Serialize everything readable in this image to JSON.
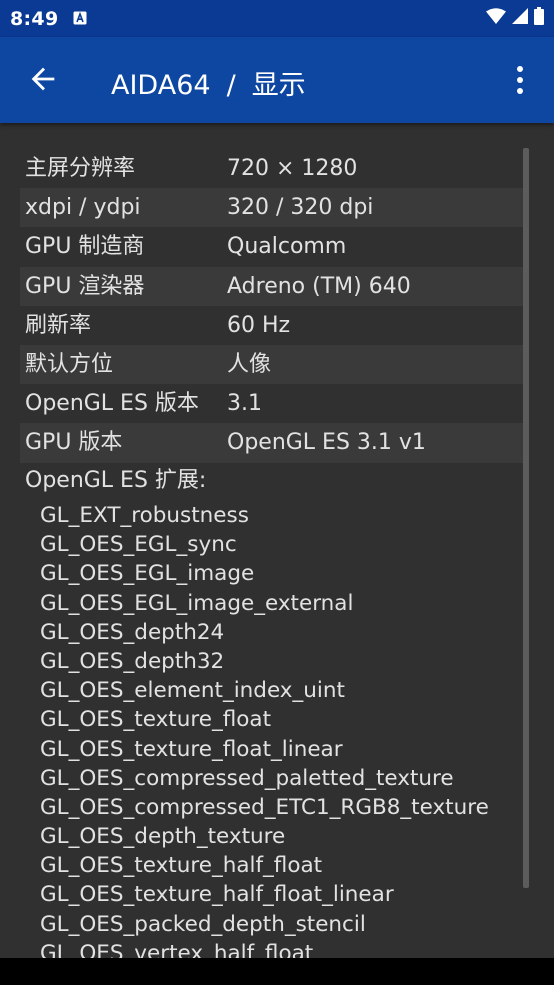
{
  "status_bar": {
    "time": "8:49",
    "icons": [
      "app-notification-icon",
      "wifi-icon",
      "cellular-signal-icon",
      "battery-icon"
    ]
  },
  "app_bar": {
    "app_name": "AIDA64",
    "separator": "/",
    "section": "显示",
    "back_icon": "arrow-back-icon",
    "menu_icon": "more-vert-icon"
  },
  "display_info": [
    {
      "label": "主屏分辨率",
      "value": "720 × 1280"
    },
    {
      "label": "xdpi / ydpi",
      "value": "320 / 320 dpi"
    },
    {
      "label": "GPU 制造商",
      "value": "Qualcomm"
    },
    {
      "label": "GPU 渲染器",
      "value": "Adreno (TM) 640"
    },
    {
      "label": "刷新率",
      "value": "60 Hz"
    },
    {
      "label": "默认方位",
      "value": "人像"
    },
    {
      "label": "OpenGL ES 版本",
      "value": "3.1"
    },
    {
      "label": "GPU 版本",
      "value": "OpenGL ES 3.1 v1"
    }
  ],
  "extensions_title": "OpenGL ES 扩展:",
  "extensions": [
    "GL_EXT_robustness",
    "GL_OES_EGL_sync",
    "GL_OES_EGL_image",
    "GL_OES_EGL_image_external",
    "GL_OES_depth24",
    "GL_OES_depth32",
    "GL_OES_element_index_uint",
    "GL_OES_texture_float",
    "GL_OES_texture_float_linear",
    "GL_OES_compressed_paletted_texture",
    "GL_OES_compressed_ETC1_RGB8_texture",
    "GL_OES_depth_texture",
    "GL_OES_texture_half_float",
    "GL_OES_texture_half_float_linear",
    "GL_OES_packed_depth_stencil",
    "GL_OES_vertex_half_float"
  ],
  "colors": {
    "status_bar": "#0a3a93",
    "app_bar": "#0d47a1",
    "background": "#303030",
    "row_alt": "#3a3a3a",
    "text": "#e2e2e2"
  }
}
